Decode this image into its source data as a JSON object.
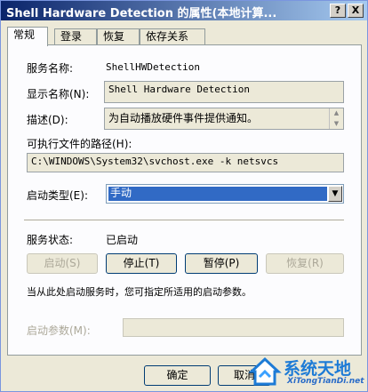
{
  "window": {
    "title": "Shell Hardware Detection 的属性(本地计算...",
    "help_button": "?",
    "close_button": "X"
  },
  "tabs": [
    {
      "label": "常规",
      "active": true
    },
    {
      "label": "登录",
      "active": false
    },
    {
      "label": "恢复",
      "active": false
    },
    {
      "label": "依存关系",
      "active": false
    }
  ],
  "general": {
    "service_name_label": "服务名称:",
    "service_name_value": "ShellHWDetection",
    "display_name_label": "显示名称(N):",
    "display_name_value": "Shell Hardware Detection",
    "description_label": "描述(D):",
    "description_value": "为自动播放硬件事件提供通知。",
    "exec_path_label": "可执行文件的路径(H):",
    "exec_path_value": "C:\\WINDOWS\\System32\\svchost.exe -k netsvcs",
    "startup_type_label": "启动类型(E):",
    "startup_type_value": "手动",
    "service_status_label": "服务状态:",
    "service_status_value": "已启动",
    "start_button": "启动(S)",
    "stop_button": "停止(T)",
    "pause_button": "暂停(P)",
    "resume_button": "恢复(R)",
    "hint_text": "当从此处启动服务时，您可指定所适用的启动参数。",
    "start_params_label": "启动参数(M):",
    "start_params_value": ""
  },
  "footer": {
    "ok_button": "确定",
    "cancel_button": "取消"
  },
  "watermark": {
    "text": "系统天地",
    "url": "XiTongTianDi.net"
  }
}
